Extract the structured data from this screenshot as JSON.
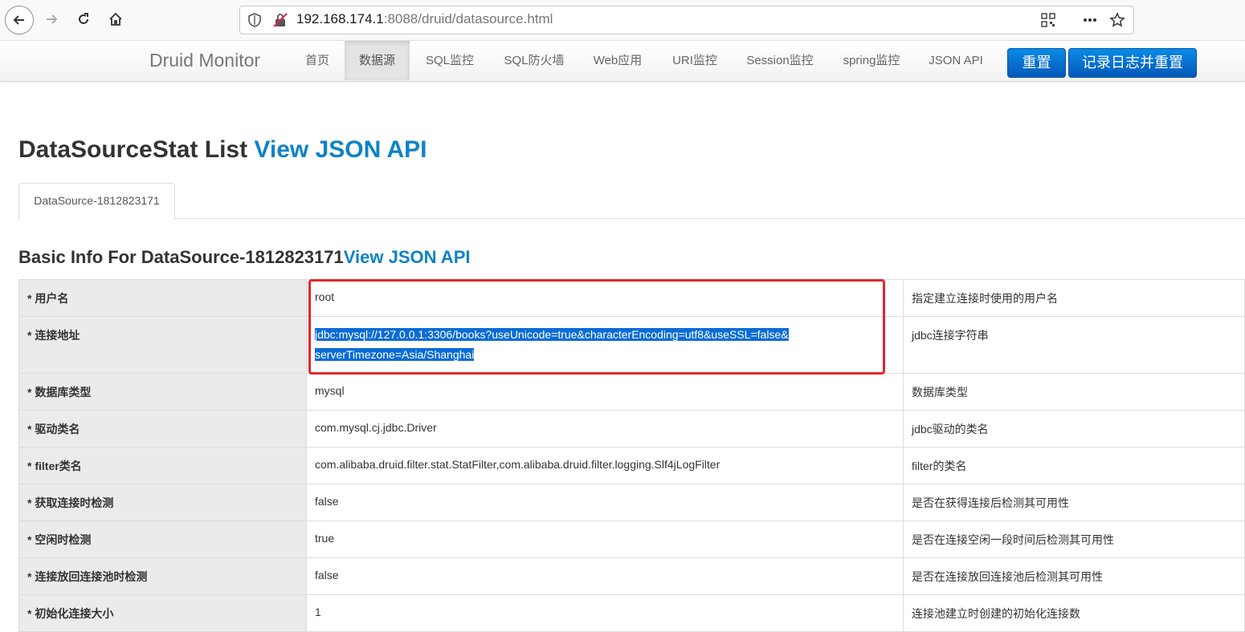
{
  "browser": {
    "url_host": "192.168.174.1",
    "url_rest": ":8088/druid/datasource.html"
  },
  "navbar": {
    "brand": "Druid Monitor",
    "items": [
      {
        "label": "首页"
      },
      {
        "label": "数据源",
        "active": true
      },
      {
        "label": "SQL监控"
      },
      {
        "label": "SQL防火墙"
      },
      {
        "label": "Web应用"
      },
      {
        "label": "URI监控"
      },
      {
        "label": "Session监控"
      },
      {
        "label": "spring监控"
      },
      {
        "label": "JSON API"
      }
    ],
    "reset_label": "重置",
    "log_reset_label": "记录日志并重置"
  },
  "page": {
    "title": "DataSourceStat List",
    "title_link": "View JSON API",
    "tab_label": "DataSource-1812823171",
    "section_title": "Basic Info For DataSource-1812823171",
    "section_link": "View JSON API"
  },
  "table": {
    "rows": [
      {
        "key": "* 用户名",
        "value": "root",
        "desc": "指定建立连接时使用的用户名"
      },
      {
        "key": "* 连接地址",
        "value_line1": "jdbc:mysql://127.0.0.1:3306/books?useUnicode=true&characterEncoding=utf8&useSSL=false&",
        "value_line2": "serverTimezone=Asia/Shanghai",
        "desc": "jdbc连接字符串"
      },
      {
        "key": "* 数据库类型",
        "value": "mysql",
        "desc": "数据库类型"
      },
      {
        "key": "* 驱动类名",
        "value": "com.mysql.cj.jdbc.Driver",
        "desc": "jdbc驱动的类名"
      },
      {
        "key": "* filter类名",
        "value": "com.alibaba.druid.filter.stat.StatFilter,com.alibaba.druid.filter.logging.Slf4jLogFilter",
        "desc": "filter的类名"
      },
      {
        "key": "* 获取连接时检测",
        "value": "false",
        "desc": "是否在获得连接后检测其可用性"
      },
      {
        "key": "* 空闲时检测",
        "value": "true",
        "desc": "是否在连接空闲一段时间后检测其可用性"
      },
      {
        "key": "* 连接放回连接池时检测",
        "value": "false",
        "desc": "是否在连接放回连接池后检测其可用性"
      },
      {
        "key": "* 初始化连接大小",
        "value": "1",
        "desc": "连接池建立时创建的初始化连接数"
      }
    ]
  },
  "colors": {
    "accent": "#0e82c6",
    "button": "#0668c9",
    "highlight_box": "#e5262b",
    "selection": "#0a6cd6"
  }
}
